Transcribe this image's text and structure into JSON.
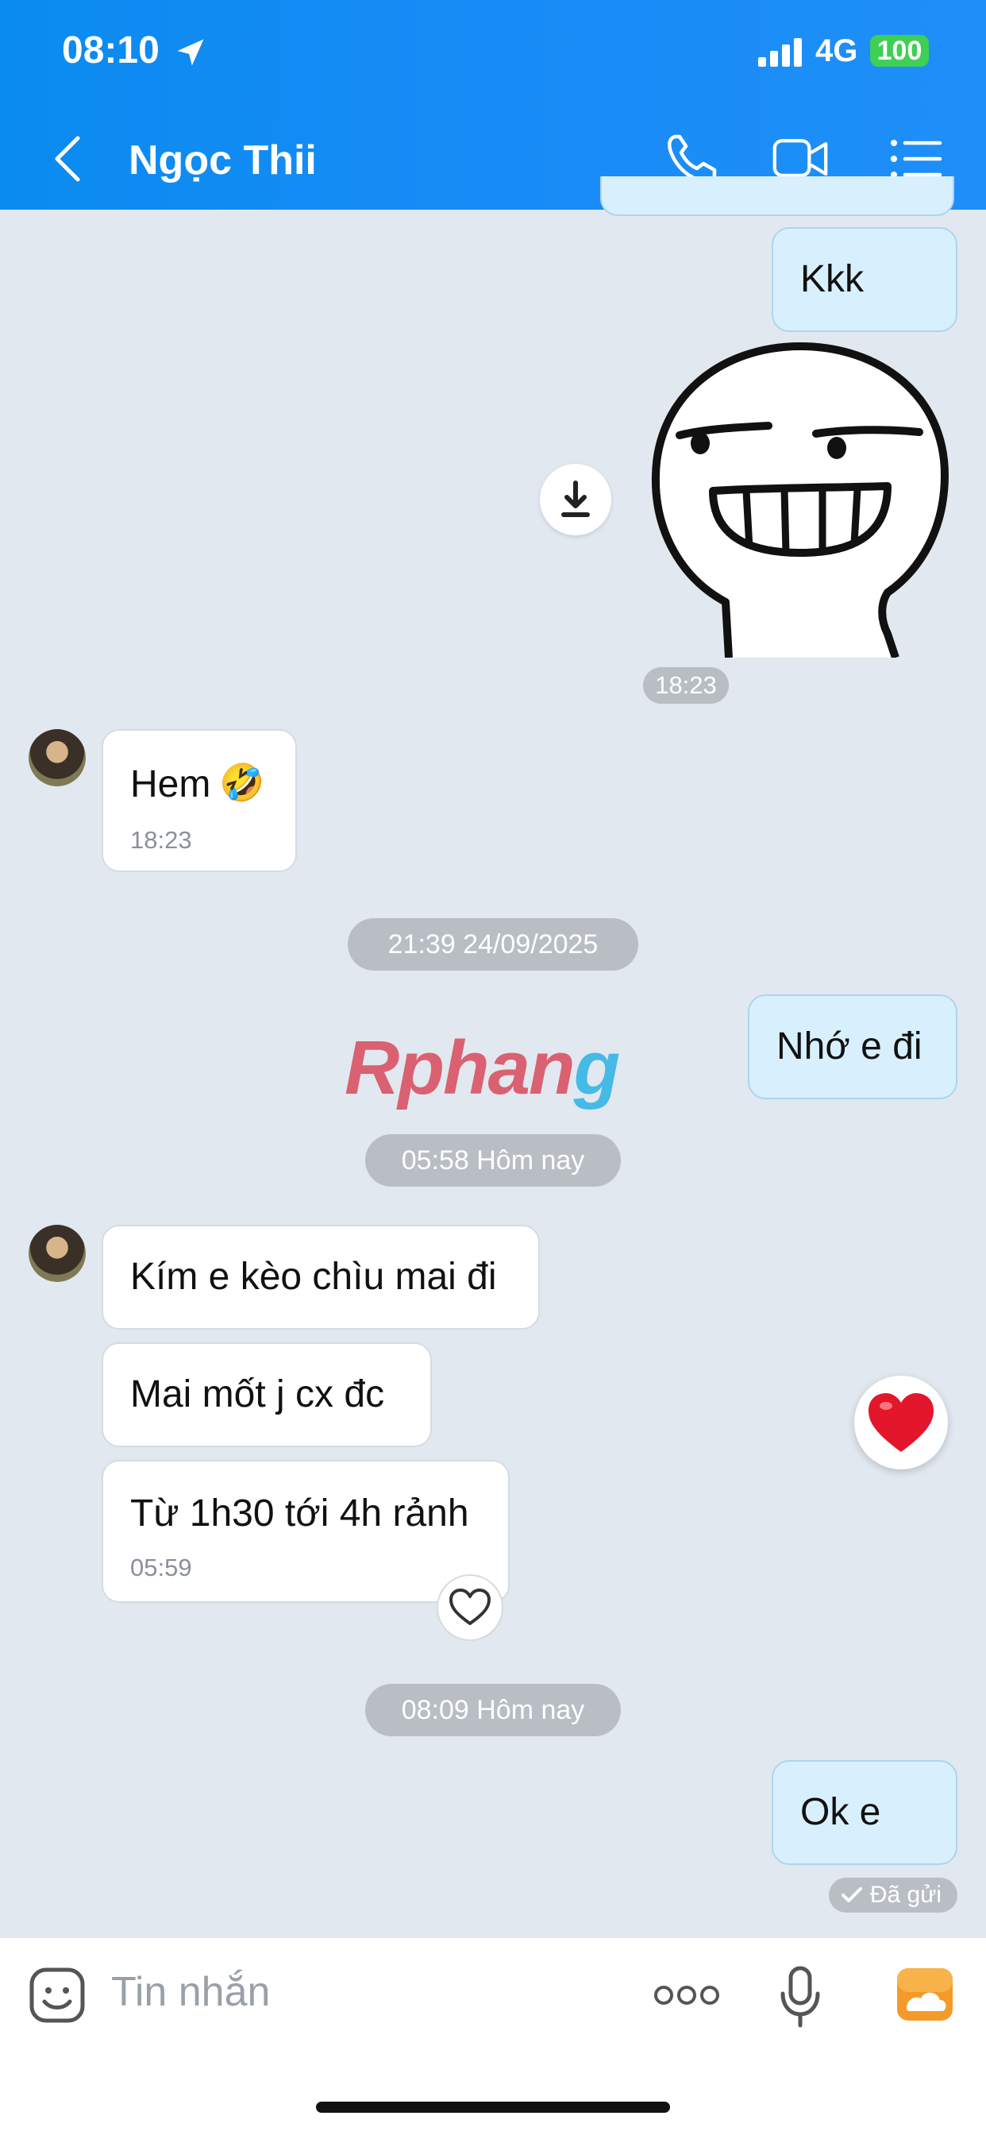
{
  "status_bar": {
    "time": "08:10",
    "network": "4G",
    "battery": "100"
  },
  "header": {
    "contact_name": "Ngọc Thii"
  },
  "messages": {
    "m1": {
      "text": "Kkk"
    },
    "sticker_time": "18:23",
    "m2": {
      "text": "Hem",
      "emoji": "🤣",
      "time": "18:23"
    },
    "sep1": "21:39 24/09/2025",
    "m3": {
      "text": "Nhớ e đi"
    },
    "sep2": "05:58 Hôm nay",
    "m4": {
      "text": "Kím e kèo chìu mai đi"
    },
    "m5": {
      "text": "Mai mốt j cx đc"
    },
    "m6": {
      "text": "Từ 1h30 tới 4h rảnh",
      "time": "05:59"
    },
    "sep3": "08:09 Hôm nay",
    "m7": {
      "text": "Ok e"
    },
    "sent_status": "Đã gửi"
  },
  "watermark": {
    "main": "Rphan",
    "tail": "g"
  },
  "input": {
    "placeholder": "Tin nhắn"
  },
  "colors": {
    "header": "#1a8cf7",
    "my_bubble": "#d8f0fd",
    "their_bubble": "#ffffff",
    "background": "#e2e8f0"
  }
}
